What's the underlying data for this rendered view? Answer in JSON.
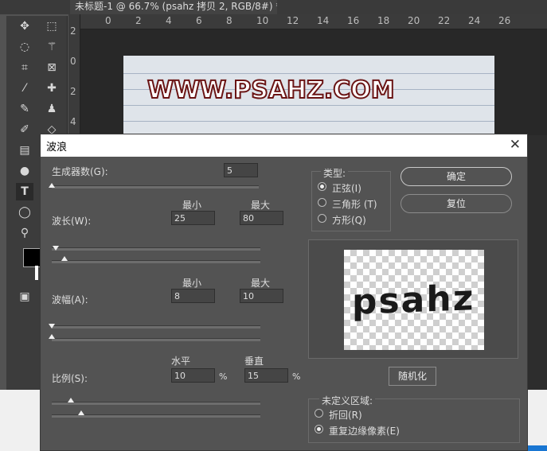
{
  "app": {
    "doc_tab": "未标题-1 @ 66.7% (psahz 拷贝 2, RGB/8#) *",
    "doc_tab_close": "×",
    "ruler_h": [
      "2",
      "0",
      "2",
      "4",
      "6",
      "8",
      "10",
      "12",
      "14",
      "16",
      "18",
      "20",
      "22",
      "24",
      "26"
    ],
    "ruler_v": [
      "2",
      "0",
      "2",
      "4"
    ],
    "watermark": "WWW.PSAHZ.COM",
    "tools": [
      "move-icon",
      "marquee-icon",
      "lasso-icon",
      "magic-wand-icon",
      "crop-icon",
      "frame-icon",
      "eyedropper-icon",
      "healing-icon",
      "brush-icon",
      "stamp-icon",
      "history-brush-icon",
      "eraser-icon",
      "gradient-icon",
      "dodge-icon",
      "pen-icon",
      "type-icon",
      "ellipse-icon",
      "zoom-icon",
      "quick-mask-icon"
    ]
  },
  "dialog": {
    "title": "波浪",
    "close": "✕",
    "generators": {
      "label": "生成器数(G):",
      "value": "5"
    },
    "wavelength": {
      "label": "波长(W):",
      "min_label": "最小",
      "max_label": "最大",
      "min": "25",
      "max": "80"
    },
    "amplitude": {
      "label": "波幅(A):",
      "min_label": "最小",
      "max_label": "最大",
      "min": "8",
      "max": "10"
    },
    "scale": {
      "label": "比例(S):",
      "h_label": "水平",
      "v_label": "垂直",
      "h": "10",
      "v": "15",
      "unit": "%"
    },
    "type": {
      "title": "类型:",
      "options": [
        "正弦(I)",
        "三角形 (T)",
        "方形(Q)"
      ],
      "selected": "正弦(I)"
    },
    "ok": "确定",
    "reset": "复位",
    "preview_text": "psahz",
    "randomize": "随机化",
    "undefined_area": {
      "title": "未定义区域:",
      "options": [
        "折回(R)",
        "重复边缘像素(E)"
      ],
      "selected": "重复边缘像素(E)"
    },
    "slider_levels": {
      "generators": 0.0,
      "wavelength_min": 0.02,
      "wavelength_max": 0.06,
      "amplitude_min": 0.0,
      "amplitude_max": 0.0,
      "scale_h": 0.09,
      "scale_v": 0.14
    }
  }
}
